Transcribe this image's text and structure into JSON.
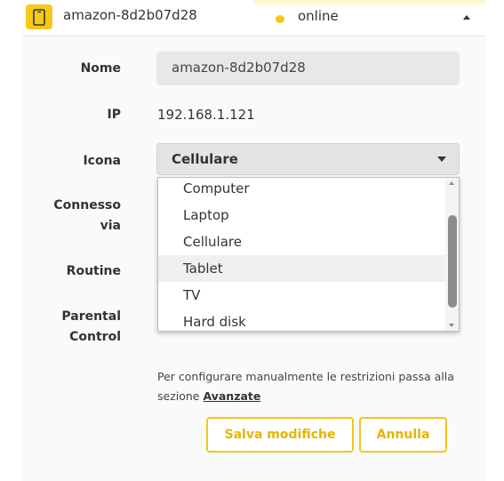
{
  "header": {
    "device_name": "amazon-8d2b07d28",
    "status": "online",
    "device_icon": "smartphone-icon",
    "status_color": "#f5c518"
  },
  "form": {
    "name_label": "Nome",
    "name_value": "amazon-8d2b07d28",
    "ip_label": "IP",
    "ip_value": "192.168.1.121",
    "icon_label": "Icona",
    "icon_selected": "Cellulare",
    "connected_label_line1": "Connesso",
    "connected_label_line2": "via",
    "routine_label": "Routine",
    "parental_label_line1": "Parental",
    "parental_label_line2": "Control"
  },
  "dropdown": {
    "options": [
      "Computer",
      "Laptop",
      "Cellulare",
      "Tablet",
      "TV",
      "Hard disk"
    ],
    "hovered": "Tablet"
  },
  "info": {
    "text": "Per configurare manualmente le restrizioni passa alla sezione ",
    "link": "Avanzate"
  },
  "buttons": {
    "save": "Salva modifiche",
    "cancel": "Annulla"
  },
  "colors": {
    "accent": "#f5c518",
    "accent_text": "#e7b400",
    "field_bg": "#e8e8e8"
  }
}
